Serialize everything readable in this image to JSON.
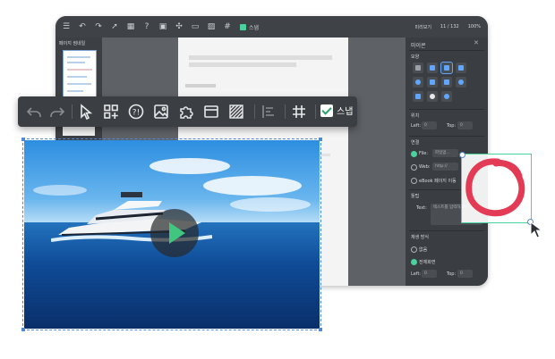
{
  "app": {
    "snap_label": "스냅",
    "page_indicator": "11 / 132",
    "zoom": "100%",
    "preview_label": "미리보기"
  },
  "left_panel": {
    "title": "페이지 썸네일"
  },
  "right_panel": {
    "title": "마이콘",
    "shape_section": "모양",
    "position_section": "위치",
    "position_left_label": "Left:",
    "position_left_value": "0",
    "position_top_label": "Top:",
    "position_top_value": "0",
    "link_section": "연결",
    "link_file_label": "File:",
    "link_file_value": "파일없...",
    "link_web_label": "Web:",
    "link_web_placeholder": "http://",
    "link_ebook_label": "eBook 페이지 이동",
    "tooltip_section": "툴팁",
    "tooltip_text_label": "Text:",
    "tooltip_placeholder": "텍스트를 입력하세요",
    "display_section": "재생 방식",
    "display_opt1": "없음",
    "display_opt2": "전체화면",
    "display_left_label": "Left:",
    "display_left_value": "0",
    "display_top_label": "Top:",
    "display_top_value": "0"
  },
  "toolbar": {
    "snap_label": "스냅",
    "snap_checked": true,
    "icons": [
      "undo-icon",
      "redo-icon",
      "select-cursor-icon",
      "add-widget-icon",
      "quiz-icon",
      "image-icon",
      "puzzle-icon",
      "window-icon",
      "pattern-icon",
      "align-icon",
      "grid-icon"
    ]
  },
  "colors": {
    "accent_green": "#49d29c",
    "play_green": "#40c67f",
    "selection_blue": "#4f8ad6",
    "stamp_red": "#e33a55",
    "toolbar_bg": "#3b3e42"
  }
}
